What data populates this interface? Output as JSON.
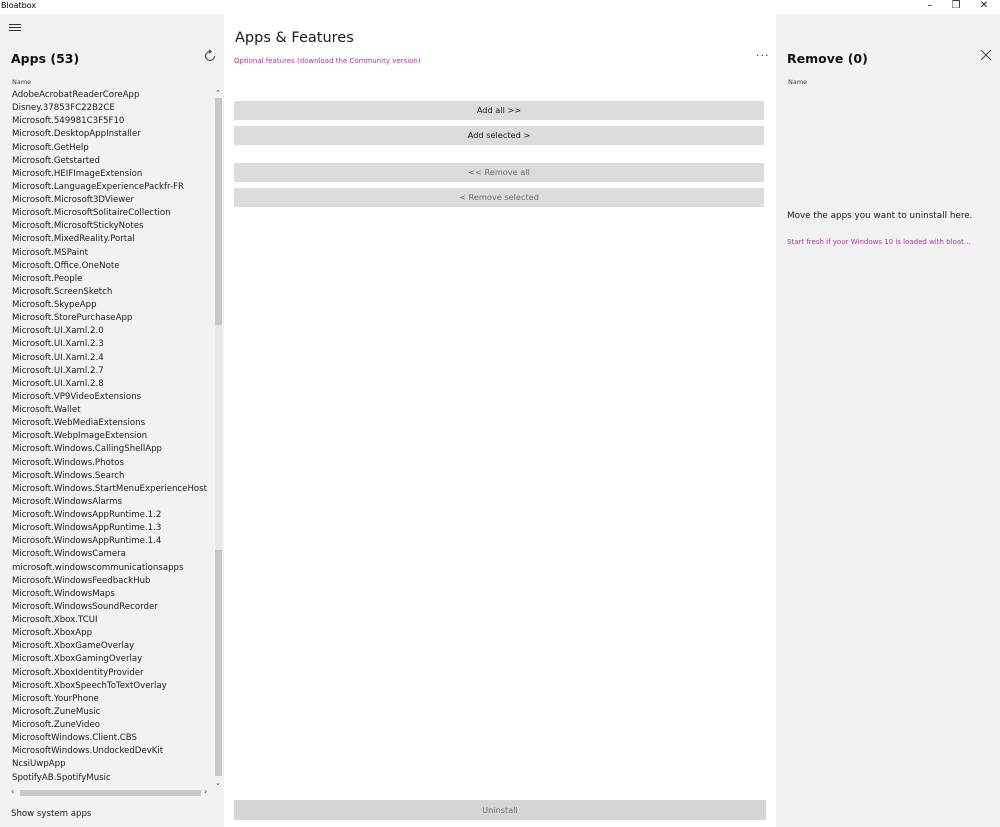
{
  "window": {
    "title": "Bloatbox",
    "minimize": "–",
    "restore": "❐",
    "close": "✕"
  },
  "left": {
    "title": "Apps (53)",
    "column_header": "Name",
    "apps": [
      "AdobeAcrobatReaderCoreApp",
      "Disney.37853FC22B2CE",
      "Microsoft.549981C3F5F10",
      "Microsoft.DesktopAppInstaller",
      "Microsoft.GetHelp",
      "Microsoft.Getstarted",
      "Microsoft.HEIFImageExtension",
      "Microsoft.LanguageExperiencePackfr-FR",
      "Microsoft.Microsoft3DViewer",
      "Microsoft.MicrosoftSolitaireCollection",
      "Microsoft.MicrosoftStickyNotes",
      "Microsoft.MixedReality.Portal",
      "Microsoft.MSPaint",
      "Microsoft.Office.OneNote",
      "Microsoft.People",
      "Microsoft.ScreenSketch",
      "Microsoft.SkypeApp",
      "Microsoft.StorePurchaseApp",
      "Microsoft.UI.Xaml.2.0",
      "Microsoft.UI.Xaml.2.3",
      "Microsoft.UI.Xaml.2.4",
      "Microsoft.UI.Xaml.2.7",
      "Microsoft.UI.Xaml.2.8",
      "Microsoft.VP9VideoExtensions",
      "Microsoft.Wallet",
      "Microsoft.WebMediaExtensions",
      "Microsoft.WebpImageExtension",
      "Microsoft.Windows.CallingShellApp",
      "Microsoft.Windows.Photos",
      "Microsoft.Windows.Search",
      "Microsoft.Windows.StartMenuExperienceHost",
      "Microsoft.WindowsAlarms",
      "Microsoft.WindowsAppRuntime.1.2",
      "Microsoft.WindowsAppRuntime.1.3",
      "Microsoft.WindowsAppRuntime.1.4",
      "Microsoft.WindowsCamera",
      "microsoft.windowscommunicationsapps",
      "Microsoft.WindowsFeedbackHub",
      "Microsoft.WindowsMaps",
      "Microsoft.WindowsSoundRecorder",
      "Microsoft.Xbox.TCUI",
      "Microsoft.XboxApp",
      "Microsoft.XboxGameOverlay",
      "Microsoft.XboxGamingOverlay",
      "Microsoft.XboxIdentityProvider",
      "Microsoft.XboxSpeechToTextOverlay",
      "Microsoft.YourPhone",
      "Microsoft.ZuneMusic",
      "Microsoft.ZuneVideo",
      "MicrosoftWindows.Client.CBS",
      "MicrosoftWindows.UndockedDevKit",
      "NcsiUwpApp",
      "SpotifyAB.SpotifyMusic"
    ],
    "show_system_apps": "Show system apps"
  },
  "middle": {
    "title": "Apps & Features",
    "optional_link": "Optional features (download the Community version)",
    "more": "···",
    "add_all": "Add all >>",
    "add_selected": "Add selected >",
    "remove_all": "<< Remove all",
    "remove_selected": "< Remove selected",
    "uninstall": "Uninstall"
  },
  "right": {
    "title": "Remove (0)",
    "column_header": "Name",
    "empty_message": "Move the apps you want to uninstall here.",
    "start_fresh_link": "Start fresh if your Windows 10 is loaded with bloat..."
  },
  "colors": {
    "accent_link": "#b135a8",
    "pane_bg": "#f2f2f2",
    "button_bg": "#dcdcdc"
  }
}
